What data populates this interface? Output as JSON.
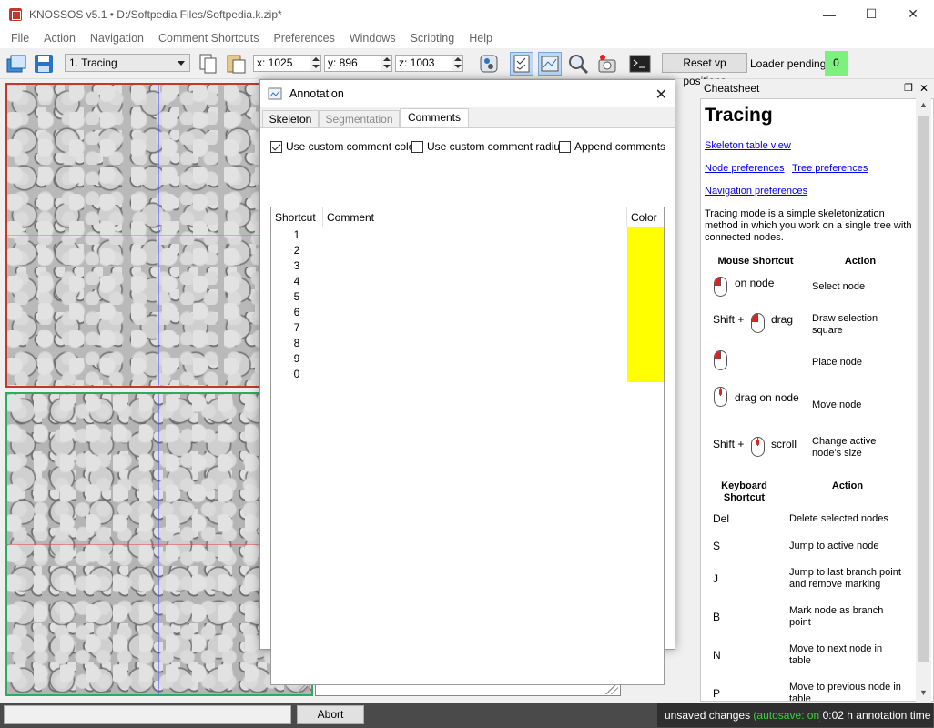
{
  "window": {
    "title": "KNOSSOS v5.1 • D:/Softpedia Files/Softpedia.k.zip*",
    "controls": [
      "minimize",
      "maximize",
      "close"
    ]
  },
  "menu": [
    "File",
    "Action",
    "Navigation",
    "Comment Shortcuts",
    "Preferences",
    "Windows",
    "Scripting",
    "Help"
  ],
  "toolbar": {
    "mode": "1. Tracing",
    "x": "x: 1025",
    "y": "y: 896",
    "z": "z: 1003",
    "reset_label": "Reset vp positions",
    "loader_label": "Loader pending:",
    "loader_value": "0",
    "loader_color": "#7ef07e"
  },
  "dialog": {
    "title": "Annotation",
    "tabs": [
      "Skeleton",
      "Segmentation",
      "Comments"
    ],
    "active_tab": "Comments",
    "options": [
      {
        "label": "Use custom comment color",
        "checked": true
      },
      {
        "label": "Use custom comment radius",
        "checked": false
      },
      {
        "label": "Append comments",
        "checked": false
      }
    ],
    "columns": [
      "Shortcut",
      "Comment",
      "Color"
    ],
    "rows": [
      {
        "shortcut": "1",
        "comment": "",
        "color": "#ffff00"
      },
      {
        "shortcut": "2",
        "comment": "",
        "color": "#ffff00"
      },
      {
        "shortcut": "3",
        "comment": "",
        "color": "#ffff00"
      },
      {
        "shortcut": "4",
        "comment": "",
        "color": "#ffff00"
      },
      {
        "shortcut": "5",
        "comment": "",
        "color": "#ffff00"
      },
      {
        "shortcut": "6",
        "comment": "",
        "color": "#ffff00"
      },
      {
        "shortcut": "7",
        "comment": "",
        "color": "#ffff00"
      },
      {
        "shortcut": "8",
        "comment": "",
        "color": "#ffff00"
      },
      {
        "shortcut": "9",
        "comment": "",
        "color": "#ffff00"
      },
      {
        "shortcut": "0",
        "comment": "",
        "color": "#ffff00"
      }
    ]
  },
  "cheatsheet": {
    "panel_title": "Cheatsheet",
    "heading": "Tracing",
    "links": {
      "skeleton_table": "Skeleton table view",
      "node_prefs": "Node preferences",
      "separator": "|",
      "tree_prefs": "Tree preferences",
      "nav_prefs": "Navigation preferences"
    },
    "intro": "Tracing mode is a simple skeletonization method in which you work on a single tree with connected nodes.",
    "mouse_header": {
      "shortcut": "Mouse Shortcut",
      "action": "Action"
    },
    "mouse_rows": [
      {
        "pre": "",
        "post": "on node",
        "action": "Select node"
      },
      {
        "pre": "Shift +",
        "post": "drag",
        "action": "Draw selection square"
      },
      {
        "pre": "",
        "post": "",
        "action": "Place node"
      },
      {
        "pre": "",
        "post": "drag on node",
        "action": "Move node"
      },
      {
        "pre": "Shift +",
        "post": "scroll",
        "action": "Change active node's size"
      }
    ],
    "keyboard_header": {
      "shortcut": "Keyboard Shortcut",
      "action": "Action"
    },
    "keyboard_rows": [
      {
        "key": "Del",
        "action": "Delete selected nodes"
      },
      {
        "key": "S",
        "action": "Jump to active node"
      },
      {
        "key": "J",
        "action": "Jump to last branch point and remove marking"
      },
      {
        "key": "B",
        "action": "Mark node as branch point"
      },
      {
        "key": "N",
        "action": "Move to next node in table"
      },
      {
        "key": "P",
        "action": "Move to previous node in table"
      }
    ]
  },
  "status": {
    "abort": "Abort",
    "unsaved": "unsaved changes",
    "autosave": "(autosave: on)",
    "time": "0:02 h annotation time"
  }
}
